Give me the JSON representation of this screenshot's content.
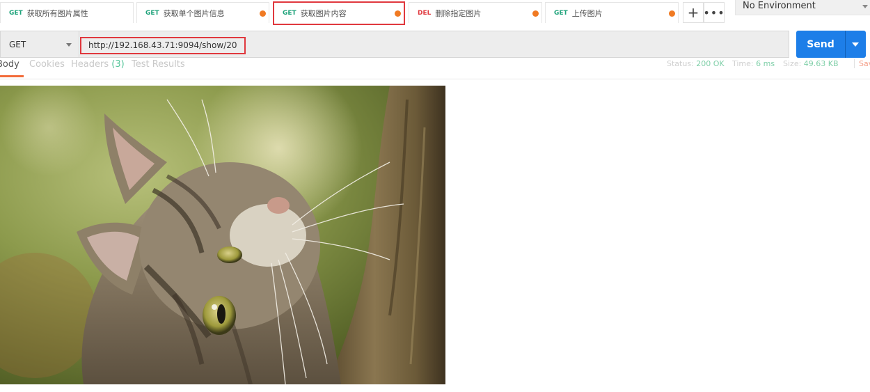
{
  "tabs": [
    {
      "method": "GET",
      "title": "获取所有图片属性",
      "unsaved": false,
      "active": false
    },
    {
      "method": "GET",
      "title": "获取单个图片信息",
      "unsaved": true,
      "active": false
    },
    {
      "method": "GET",
      "title": "获取图片内容",
      "unsaved": true,
      "active": true
    },
    {
      "method": "DEL",
      "title": "删除指定图片",
      "unsaved": true,
      "active": false
    },
    {
      "method": "GET",
      "title": "上传图片",
      "unsaved": true,
      "active": false
    }
  ],
  "tab_controls": {
    "add_label": "+",
    "more_label": "•••"
  },
  "environment": {
    "selected": "No Environment"
  },
  "request": {
    "method": "GET",
    "url": "http://192.168.43.71:9094/show/20",
    "send_label": "Send"
  },
  "response": {
    "tabs": [
      {
        "label": "Body",
        "active": true
      },
      {
        "label": "Cookies",
        "active": false
      },
      {
        "label": "Headers",
        "count": "(3)",
        "active": false
      },
      {
        "label": "Test Results",
        "active": false
      }
    ],
    "status_label": "Status:",
    "status_value": "200 OK",
    "time_label": "Time:",
    "time_value": "6 ms",
    "size_label": "Size:",
    "size_value": "49.63 KB",
    "save_fragment": "Save"
  },
  "colors": {
    "get": "#1fa37b",
    "del": "#e0383e",
    "send": "#1d7ee8",
    "highlight": "#e0383e",
    "unsaved_dot": "#f07a23"
  },
  "image": {
    "subject": "tabby cat looking up beside a tree trunk"
  }
}
